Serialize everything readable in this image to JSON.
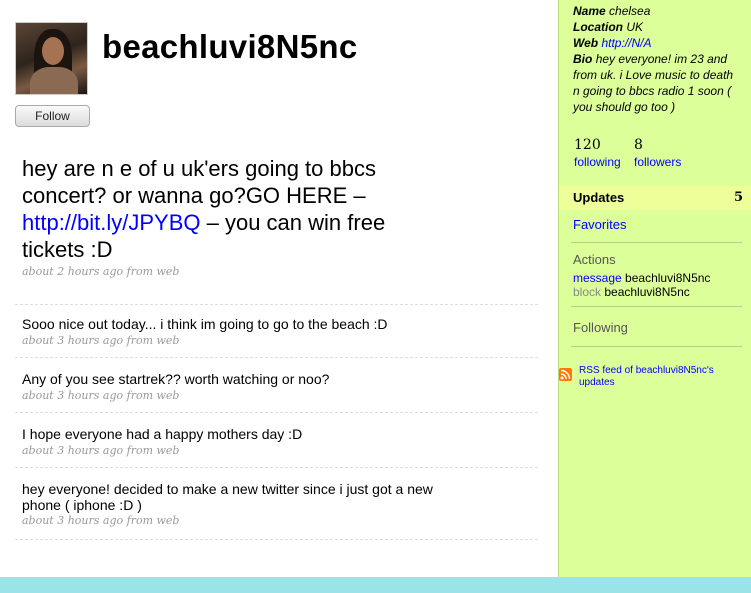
{
  "profile": {
    "username": "beachluvi8N5nc",
    "follow_label": "Follow"
  },
  "featured": {
    "text_before": "hey are n e of u uk'ers going to bbcs concert? or wanna go?GO HERE – ",
    "link": "http://bit.ly/JPYBQ",
    "text_after": " – you can win free tickets :D",
    "meta": "about 2 hours ago from web"
  },
  "tweets": [
    {
      "text": "Sooo nice out today... i think im going to go to the beach :D",
      "meta": "about 3 hours ago from web"
    },
    {
      "text": "Any of you see startrek?? worth watching or noo?",
      "meta": "about 3 hours ago from web"
    },
    {
      "text": "I hope everyone had a happy mothers day :D",
      "meta": "about 3 hours ago from web"
    },
    {
      "text": "hey everyone! decided to make a new twitter since i just got a new phone ( iphone :D )",
      "meta": "about 3 hours ago from web"
    }
  ],
  "sidebar": {
    "name_label": "Name",
    "name_value": "chelsea",
    "location_label": "Location",
    "location_value": "UK",
    "web_label": "Web",
    "web_value": "http://N/A",
    "bio_label": "Bio",
    "bio_value": "hey everyone! im 23 and from uk. i Love music to death n going to bbcs radio 1 soon ( you should go too )",
    "following_count": "120",
    "following_label": "following",
    "followers_count": "8",
    "followers_label": "followers",
    "updates_label": "Updates",
    "updates_count": "5",
    "favorites_label": "Favorites",
    "actions_label": "Actions",
    "message_label": "message",
    "block_label": "block",
    "action_target": "beachluvi8N5nc",
    "following_section": "Following",
    "rss_text": "RSS feed of beachluvi8N5nc's updates"
  },
  "colors": {
    "background": "#9ae4e8",
    "sidebar": "#ddff99",
    "link": "#0000ff"
  }
}
